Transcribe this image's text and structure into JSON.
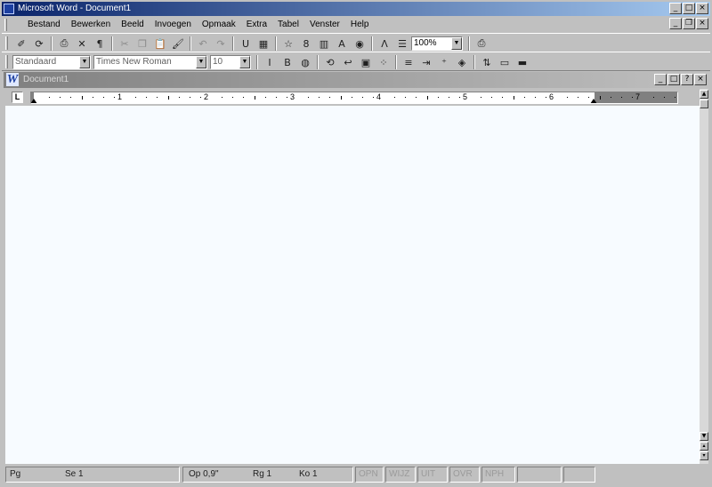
{
  "window": {
    "title": "Microsoft Word - Document1"
  },
  "menu": [
    "Bestand",
    "Bewerken",
    "Beeld",
    "Invoegen",
    "Opmaak",
    "Extra",
    "Tabel",
    "Venster",
    "Help"
  ],
  "toolbar1": {
    "buttons": [
      {
        "name": "open-icon",
        "glyph": "✐",
        "dim": false
      },
      {
        "name": "save-icon",
        "glyph": "⟳",
        "dim": false
      },
      {
        "sep": true
      },
      {
        "name": "preview-icon",
        "glyph": "⎙",
        "dim": false
      },
      {
        "name": "spelling-icon",
        "glyph": "✕",
        "dim": false
      },
      {
        "name": "paragraph-icon",
        "glyph": "¶",
        "dim": false
      },
      {
        "sep": true
      },
      {
        "name": "cut-icon",
        "glyph": "✂",
        "dim": true
      },
      {
        "name": "copy-icon",
        "glyph": "❐",
        "dim": true
      },
      {
        "name": "paste-icon",
        "glyph": "📋",
        "dim": false
      },
      {
        "name": "format-painter-icon",
        "glyph": "🖌",
        "dim": false
      },
      {
        "sep": true
      },
      {
        "name": "undo-icon",
        "glyph": "↶",
        "dim": true
      },
      {
        "name": "redo-icon",
        "glyph": "↷",
        "dim": true
      },
      {
        "sep": true
      },
      {
        "name": "underline-icon",
        "glyph": "U",
        "dim": false
      },
      {
        "name": "table-icon",
        "glyph": "▦",
        "dim": false
      },
      {
        "sep": true
      },
      {
        "name": "star-icon",
        "glyph": "☆",
        "dim": false
      },
      {
        "name": "insert-icon",
        "glyph": "8",
        "dim": false
      },
      {
        "name": "columns-icon",
        "glyph": "▥",
        "dim": false
      },
      {
        "name": "font-size-icon",
        "glyph": "A",
        "dim": false
      },
      {
        "name": "globe-icon",
        "glyph": "◉",
        "dim": false
      },
      {
        "sep": true
      },
      {
        "name": "drawing-icon",
        "glyph": "Λ",
        "dim": false
      },
      {
        "name": "list-icon",
        "glyph": "☰",
        "dim": false
      }
    ],
    "zoom": "100%",
    "print_icon": "printer-icon"
  },
  "toolbar2": {
    "style": "Standaard",
    "font": "Times New Roman",
    "size": "10",
    "buttons": [
      {
        "name": "italic-icon",
        "glyph": "I",
        "dim": false
      },
      {
        "name": "bold-icon",
        "glyph": "B",
        "dim": false
      },
      {
        "name": "web-icon",
        "glyph": "◍",
        "dim": false
      },
      {
        "sep": true
      },
      {
        "name": "back-icon",
        "glyph": "⟲",
        "dim": false
      },
      {
        "name": "forward-icon",
        "glyph": "↩",
        "dim": false
      },
      {
        "name": "clipboard-icon",
        "glyph": "▣",
        "dim": false
      },
      {
        "name": "decimal-icon",
        "glyph": "⁘",
        "dim": false
      },
      {
        "sep": true
      },
      {
        "name": "line-spacing-icon",
        "glyph": "≡",
        "dim": false
      },
      {
        "name": "indent-icon",
        "glyph": "⇥",
        "dim": false
      },
      {
        "name": "decimal-plus-icon",
        "glyph": "⁺",
        "dim": false
      },
      {
        "name": "fill-color-icon",
        "glyph": "◈",
        "dim": false
      },
      {
        "sep": true
      },
      {
        "name": "sort-icon",
        "glyph": "⇅",
        "dim": false
      },
      {
        "name": "border-icon",
        "glyph": "▭",
        "dim": false
      },
      {
        "name": "font-color-icon",
        "glyph": "▬",
        "dim": false
      }
    ]
  },
  "document": {
    "title": "Document1"
  },
  "ruler": {
    "numbers": [
      "1",
      "2",
      "3",
      "4",
      "5",
      "6",
      "7"
    ],
    "tab_selector": "L"
  },
  "status": {
    "page": "Pg",
    "section": "Se 1",
    "position": "Op 0,9\"",
    "line": "Rg 1",
    "column": "Ko 1",
    "modes": [
      "OPN",
      "WIJZ",
      "UIT",
      "OVR",
      "NPH"
    ]
  },
  "colors": {
    "titlebar_active": "#0a246a",
    "face": "#c0c0c0",
    "page": "#f7fbff"
  }
}
